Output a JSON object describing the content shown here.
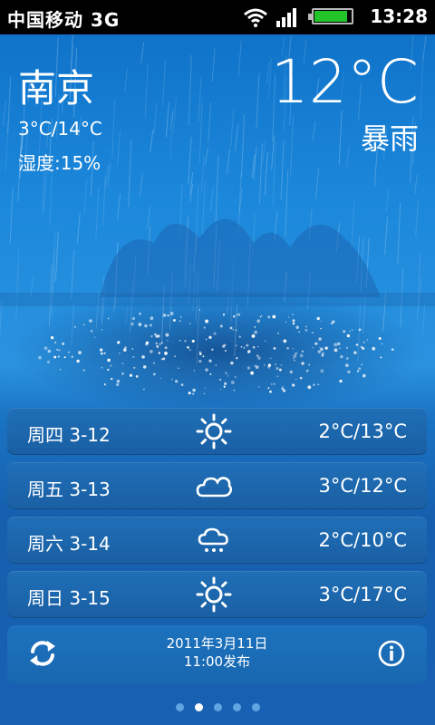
{
  "status_bar": {
    "carrier": "中国移动",
    "network": "3G",
    "time": "13:28",
    "icons": [
      "wifi-icon",
      "signal-icon",
      "battery-icon"
    ],
    "battery_level": 0.85
  },
  "current": {
    "city": "南京",
    "temp_range": "3°C/14°C",
    "humidity": "湿度:15%",
    "temperature": "12°C",
    "condition": "暴雨"
  },
  "forecast": [
    {
      "day": "周四 3-12",
      "icon": "sun-icon",
      "range": "2°C/13°C"
    },
    {
      "day": "周五 3-13",
      "icon": "cloud-icon",
      "range": "3°C/12°C"
    },
    {
      "day": "周六 3-14",
      "icon": "rain-cloud-icon",
      "range": "2°C/10°C"
    },
    {
      "day": "周日 3-15",
      "icon": "sun-icon",
      "range": "3°C/17°C"
    }
  ],
  "footer": {
    "publish_date": "2011年3月11日",
    "publish_time": "11:00发布"
  },
  "pager": {
    "total": 5,
    "active": 1
  },
  "colors": {
    "accent": "#1c88db",
    "row": "#1f6fb7"
  }
}
